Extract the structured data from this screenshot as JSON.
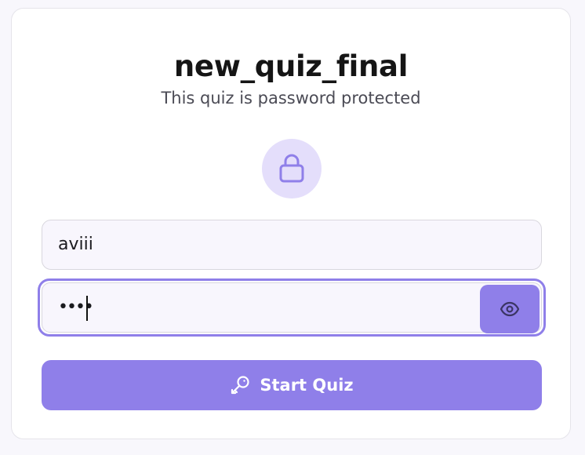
{
  "quiz": {
    "title": "new_quiz_final",
    "subtitle": "This quiz is password protected"
  },
  "form": {
    "username_value": "aviii",
    "password_masked": "••••",
    "start_label": "Start Quiz"
  },
  "icons": {
    "lock": "lock-icon",
    "eye": "eye-icon",
    "key": "key-icon"
  },
  "colors": {
    "accent": "#8f7fe9",
    "lock_bg": "#e4defb"
  }
}
